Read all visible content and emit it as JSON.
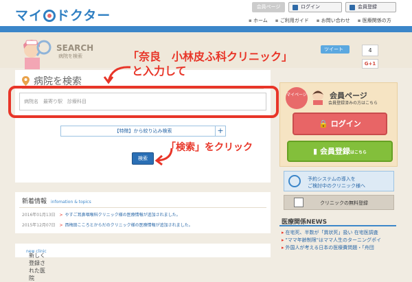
{
  "header": {
    "logo_text_1": "マイ",
    "logo_text_2": "ドクター",
    "tab_kaiin": "会員ページ",
    "login_label": "ログイン",
    "register_label": "会員登録",
    "nav": [
      "ホーム",
      "ご利用ガイド",
      "お問い合わせ",
      "医療関係の方"
    ]
  },
  "hero": {
    "search_title": "SEARCH",
    "search_sub": "病院を検索",
    "tweet": "ツイート",
    "tweet_count": "4",
    "gplus": "G+1"
  },
  "annotations": {
    "step1_line1": "「奈良　小林皮ふ科クリニック」",
    "step1_line2": "と入力して",
    "step2": "「検索」をクリック"
  },
  "search_panel": {
    "title": "病院を検索",
    "placeholder": "病院名　最寄り駅　診療科目",
    "filter_label": "【特徴】から絞り込み検索",
    "plus": "+",
    "search_button": "検索"
  },
  "news": {
    "title": "新着情報",
    "subtitle": "infomation & topics",
    "items": [
      {
        "date": "2016年01月13日",
        "text": "やすご耳鼻咽喉科クリニック様の医療情報が追加されました。"
      },
      {
        "date": "2015年12月07日",
        "text": "西梅田こころとからだのクリニック様の医療情報が追加されました。"
      }
    ]
  },
  "new_clinics": {
    "title": "新しく登録された医院",
    "subtitle": "new clinic"
  },
  "sidebar": {
    "badge": "マイページ",
    "kaiin_title": "会員ページ",
    "kaiin_sub": "会員登録済みの方はこちら",
    "login_button": "ログイン",
    "register_button": "会員登録",
    "register_suffix": "はこちら",
    "system_text_1": "予約システムの導入を",
    "system_text_2": "ご検討中のクリニック様へ",
    "free_register": "クリニックの無料登録",
    "medical_news_title": "医療関係NEWS",
    "medical_news": [
      "在宅死、半数が「異状死」扱い 在宅医調査",
      "\"ママ年齢制限\"はママ人生のターニングポイ",
      "外国人が考える日本の医療費問題・「舟団"
    ]
  }
}
